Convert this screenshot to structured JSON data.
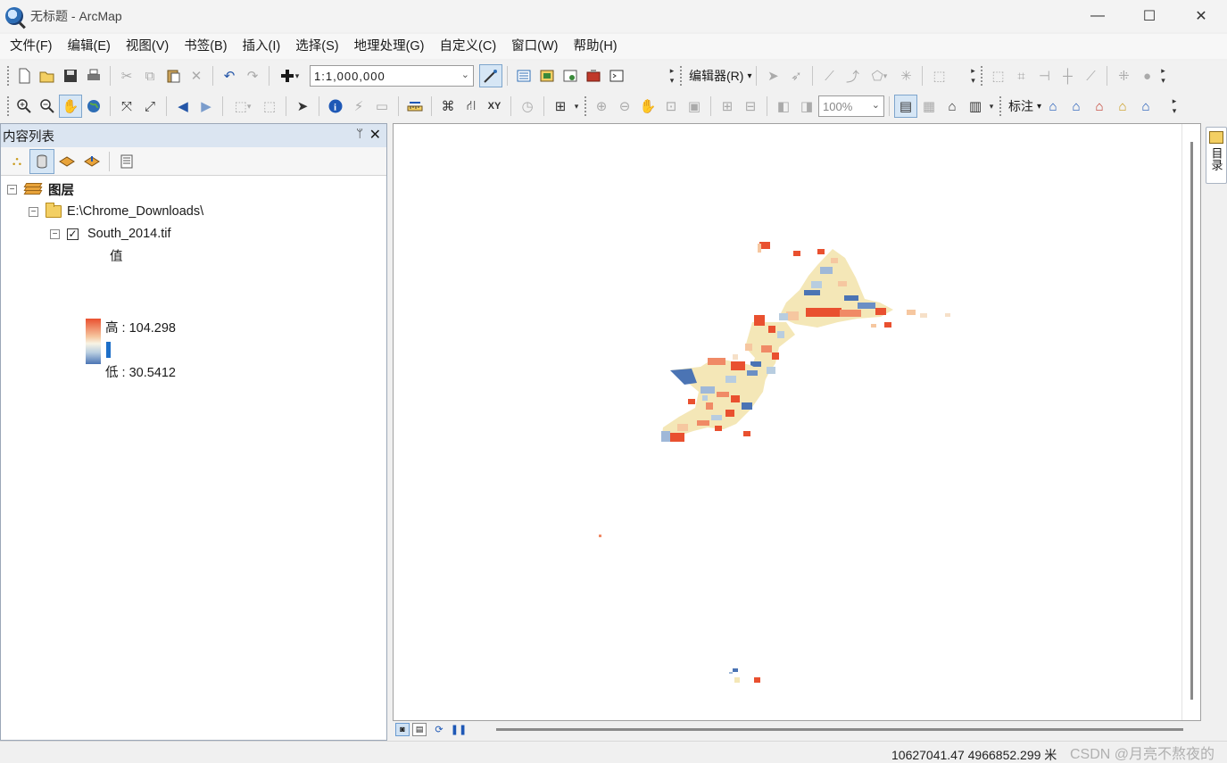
{
  "window": {
    "title": "无标题 - ArcMap",
    "minimize": "—",
    "maximize": "☐",
    "close": "✕"
  },
  "menu": [
    "文件(F)",
    "编辑(E)",
    "视图(V)",
    "书签(B)",
    "插入(I)",
    "选择(S)",
    "地理处理(G)",
    "自定义(C)",
    "窗口(W)",
    "帮助(H)"
  ],
  "toolbar": {
    "scale_value": "1:1,000,000",
    "editor_label": "编辑器(R)",
    "zoom_value": "100%",
    "label_tool": "标注"
  },
  "toc": {
    "title": "内容列表",
    "pin": "ᛘ",
    "close": "✕",
    "root": "图层",
    "folder": "E:\\Chrome_Downloads\\",
    "layer": "South_2014.tif",
    "value_label": "值",
    "high_label": "高 : 104.298",
    "low_label": "低 : 30.5412"
  },
  "catalog_tab": "目录",
  "status": {
    "coordinates": "10627041.47  4966852.299 米"
  },
  "watermark": "CSDN @月亮不熬夜的",
  "colors": {
    "high": "#e9502f",
    "mid": "#f8f4e5",
    "low": "#4b74b4"
  }
}
